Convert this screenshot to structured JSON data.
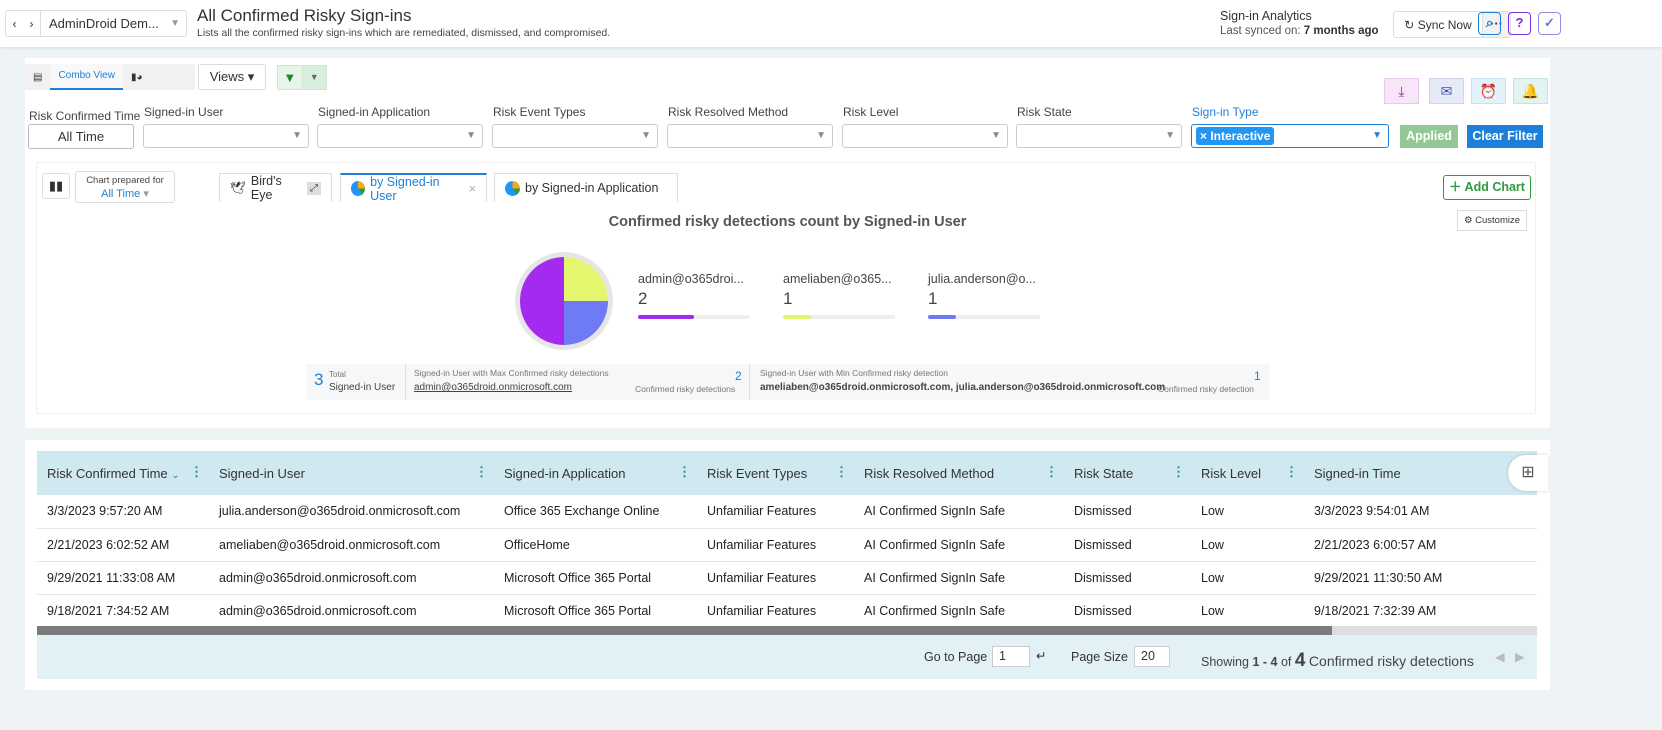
{
  "header": {
    "tenant": "AdminDroid Dem...",
    "title": "All Confirmed Risky Sign-ins",
    "subtitle": "Lists all the confirmed risky sign-ins which are remediated, dismissed, and compromised.",
    "category": "Sign-in Analytics",
    "last_synced_label": "Last synced on:",
    "last_synced_value": "7 months ago",
    "sync_label": "Sync Now",
    "more": "···"
  },
  "toolbar": {
    "combo_view": "Combo View",
    "views": "Views"
  },
  "filters": {
    "risk_confirmed_time": {
      "label": "Risk Confirmed Time",
      "value": "All Time"
    },
    "signed_in_user": "Signed-in User",
    "signed_in_application": "Signed-in Application",
    "risk_event_types": "Risk Event Types",
    "risk_resolved_method": "Risk Resolved Method",
    "risk_level": "Risk Level",
    "risk_state": "Risk State",
    "sign_in_type": {
      "label": "Sign-in Type",
      "chip": "Interactive"
    },
    "applied": "Applied",
    "clear": "Clear Filter"
  },
  "chart": {
    "prepared_label": "Chart prepared for",
    "prepared_value": "All Time",
    "tabs": [
      "Bird's Eye",
      "by Signed-in User",
      "by Signed-in Application"
    ],
    "add_chart": "Add Chart",
    "customize": "Customize"
  },
  "chart_data": {
    "type": "pie",
    "title": "Confirmed risky detections count by Signed-in User",
    "categories": [
      "admin@o365droi...",
      "ameliaben@o365...",
      "julia.anderson@o..."
    ],
    "values": [
      2,
      1,
      1
    ],
    "colors": [
      "#a52af0",
      "#e4f56e",
      "#6f7bf5"
    ],
    "max": 4
  },
  "summary": {
    "total": "3",
    "total_label1": "Total",
    "total_label2": "Signed-in User",
    "max_label": "Signed-in User with Max Confirmed risky detections",
    "max_user": "admin@o365droid.onmicrosoft.com",
    "max_count": "2",
    "max_unit": "Confirmed risky detections",
    "min_label": "Signed-in User with Min Confirmed risky detection",
    "min_users": "ameliaben@o365droid.onmicrosoft.com, julia.anderson@o365droid.onmicrosoft.com",
    "min_count": "1",
    "min_unit": "Confirmed risky detection"
  },
  "table": {
    "columns": [
      "Risk Confirmed Time",
      "Signed-in User",
      "Signed-in Application",
      "Risk Event Types",
      "Risk Resolved Method",
      "Risk State",
      "Risk Level",
      "Signed-in Time"
    ],
    "rows": [
      [
        "3/3/2023 9:57:20 AM",
        "julia.anderson@o365droid.onmicrosoft.com",
        "Office 365 Exchange Online",
        "Unfamiliar Features",
        "AI Confirmed SignIn Safe",
        "Dismissed",
        "Low",
        "3/3/2023 9:54:01 AM"
      ],
      [
        "2/21/2023 6:02:52 AM",
        "ameliaben@o365droid.onmicrosoft.com",
        "OfficeHome",
        "Unfamiliar Features",
        "AI Confirmed SignIn Safe",
        "Dismissed",
        "Low",
        "2/21/2023 6:00:57 AM"
      ],
      [
        "9/29/2021 11:33:08 AM",
        "admin@o365droid.onmicrosoft.com",
        "Microsoft Office 365 Portal",
        "Unfamiliar Features",
        "AI Confirmed SignIn Safe",
        "Dismissed",
        "Low",
        "9/29/2021 11:30:50 AM"
      ],
      [
        "9/18/2021 7:34:52 AM",
        "admin@o365droid.onmicrosoft.com",
        "Microsoft Office 365 Portal",
        "Unfamiliar Features",
        "AI Confirmed SignIn Safe",
        "Dismissed",
        "Low",
        "9/18/2021 7:32:39 AM"
      ]
    ]
  },
  "pager": {
    "goto": "Go to Page",
    "page": "1",
    "page_size_label": "Page Size",
    "page_size": "20",
    "showing": "Showing",
    "range": "1 - 4",
    "of": "of",
    "total": "4",
    "unit": "Confirmed risky detections"
  }
}
